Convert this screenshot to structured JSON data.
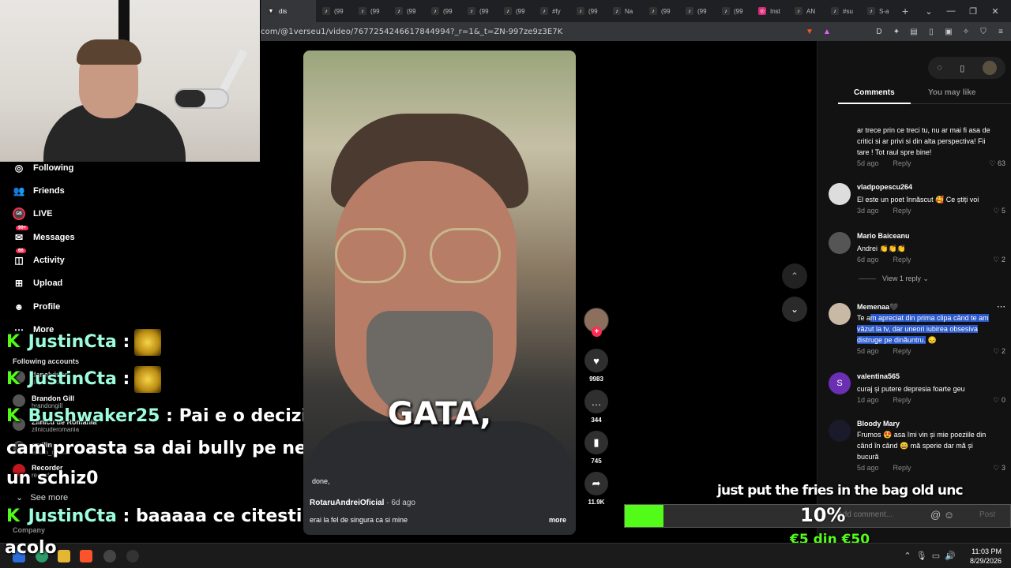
{
  "browser": {
    "tabs": [
      "dis",
      "(99",
      "(99",
      "(99",
      "(99",
      "(99",
      "(99",
      "#fy",
      "(99",
      "Na",
      "(99",
      "(99",
      "(99",
      "Inst",
      "AN",
      "#su",
      "S-a"
    ],
    "url": "com/@1verseu1/video/7677254246617844994?_r=1&_t=ZN-997ze9z3E7K"
  },
  "sidebar": {
    "items": [
      {
        "label": "Following",
        "icon": "following-icon"
      },
      {
        "label": "Friends",
        "icon": "friends-icon"
      },
      {
        "label": "LIVE",
        "icon": "live-icon"
      },
      {
        "label": "Messages",
        "icon": "messages-icon",
        "badge": "99+"
      },
      {
        "label": "Activity",
        "icon": "activity-icon",
        "badge": "66"
      },
      {
        "label": "Upload",
        "icon": "upload-icon"
      },
      {
        "label": "Profile",
        "icon": "profile-icon"
      },
      {
        "label": "More",
        "icon": "more-icon"
      }
    ],
    "following_header": "Following accounts",
    "accounts": [
      {
        "name": "danelvirlan",
        "handle": "dabenistory"
      },
      {
        "name": "Brandon Gill",
        "handle": "brandongill"
      },
      {
        "name": "Zilnicu de Romania",
        "handle": "zilnicuderomania"
      },
      {
        "name": "emilin",
        "handle": "emilin_malina"
      },
      {
        "name": "Recorder",
        "handle": "recorder"
      }
    ],
    "see_more": "See more",
    "company": "Company"
  },
  "chat": [
    {
      "user": "JustinCta",
      "text": " :",
      "emote": true
    },
    {
      "user": "JustinCta",
      "text": " :",
      "emote": true
    },
    {
      "user": "Bushwaker25",
      "text": " : Pai e o decizie"
    },
    {
      "user": "",
      "text": "cam proasta sa dai bully pe net la"
    },
    {
      "user": "",
      "text": "un schiz0"
    },
    {
      "user": "JustinCta",
      "text": " : baaaaa ce citesti"
    }
  ],
  "chat_tail": "acolo",
  "video": {
    "caption": "GATA,",
    "overlay_text": "done,",
    "author": "RotaruAndreiOficial",
    "age": " · 6d ago",
    "description": "erai la fel de singura ca si mine",
    "more": "more"
  },
  "actions": {
    "likes": "9983",
    "comments": "344",
    "saves": "745",
    "shares": "11.9K"
  },
  "panel": {
    "tabs": [
      "Comments",
      "You may like"
    ],
    "comments": [
      {
        "user": "",
        "text": "ar trece prin ce treci tu, nu ar mai fi asa de critici si ar privi si din alta perspectiva! Fii tare ! Tot raul spre bine!",
        "age": "5d ago",
        "reply": "Reply",
        "likes": "63"
      },
      {
        "user": "vladpopescu264",
        "text": "El este un poet înnăscut 🥰 Ce știți voi",
        "age": "3d ago",
        "reply": "Reply",
        "likes": "5"
      },
      {
        "user": "Mario Baiceanu",
        "text": "Andrei 👏👏👏",
        "age": "6d ago",
        "reply": "Reply",
        "likes": "2"
      },
      {
        "user": "Memenaa🖤",
        "text_pre": "Te a",
        "text_hl": "m apreciat din prima clipa când te am văzut la tv, dar uneori iubirea obsesiva distruge pe dinăuntru.",
        "text_post": " 😔",
        "age": "5d ago",
        "reply": "Reply",
        "likes": "2"
      },
      {
        "user": "valentina565",
        "text": "curaj și putere depresia foarte geu",
        "age": "1d ago",
        "reply": "Reply",
        "likes": "0"
      },
      {
        "user": "Bloody Mary",
        "text": "Frumos 😍 asa îmi vin și mie poeziile din când în când 😄 mă sperie dar mă și bucură",
        "age": "5d ago",
        "reply": "Reply",
        "likes": "3"
      }
    ],
    "view_reply": "View 1 reply ⌄",
    "input_placeholder": "Add comment...",
    "post": "Post"
  },
  "overlay": {
    "ticker": "just put the fries in the bag old unc",
    "goal_progress": 0.1,
    "goal_percent": "10%",
    "goal_amount": "€5 din €50",
    "colors": {
      "kick_green": "#53fc18",
      "tiktok_red": "#fe2c55",
      "highlight": "#2a57c9"
    }
  },
  "taskbar": {
    "time": "11:03 PM",
    "date": "8/29/2026"
  }
}
